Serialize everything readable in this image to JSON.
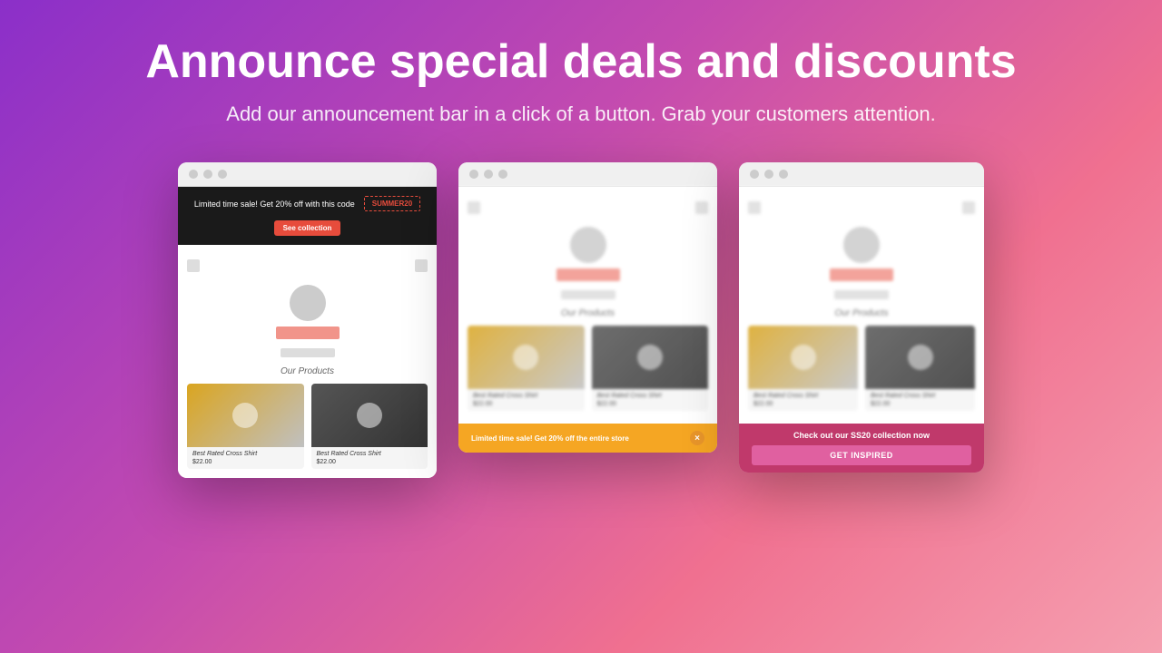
{
  "page": {
    "title": "Announce special deals and discounts",
    "subtitle": "Add our announcement bar in a click of a button. Grab your customers attention."
  },
  "mockup_left": {
    "announcement": {
      "text": "Limited time sale! Get 20% off with this code",
      "coupon": "SUMMER20",
      "button": "See collection"
    },
    "products_heading": "Our Products",
    "products": [
      {
        "name": "Best Rated Cross Shirt",
        "price": "$22.00"
      },
      {
        "name": "Best Rated Cross Shirt",
        "price": "$22.00"
      }
    ]
  },
  "mockup_middle": {
    "products_heading": "Our Products",
    "bottom_banner": {
      "text": "Limited time sale! Get 20% off the entire store",
      "close": "×"
    }
  },
  "mockup_right": {
    "products_heading": "Our Products",
    "bottom_banner": {
      "title": "Check out our SS20 collection now",
      "button": "GET INSPIRED"
    }
  }
}
